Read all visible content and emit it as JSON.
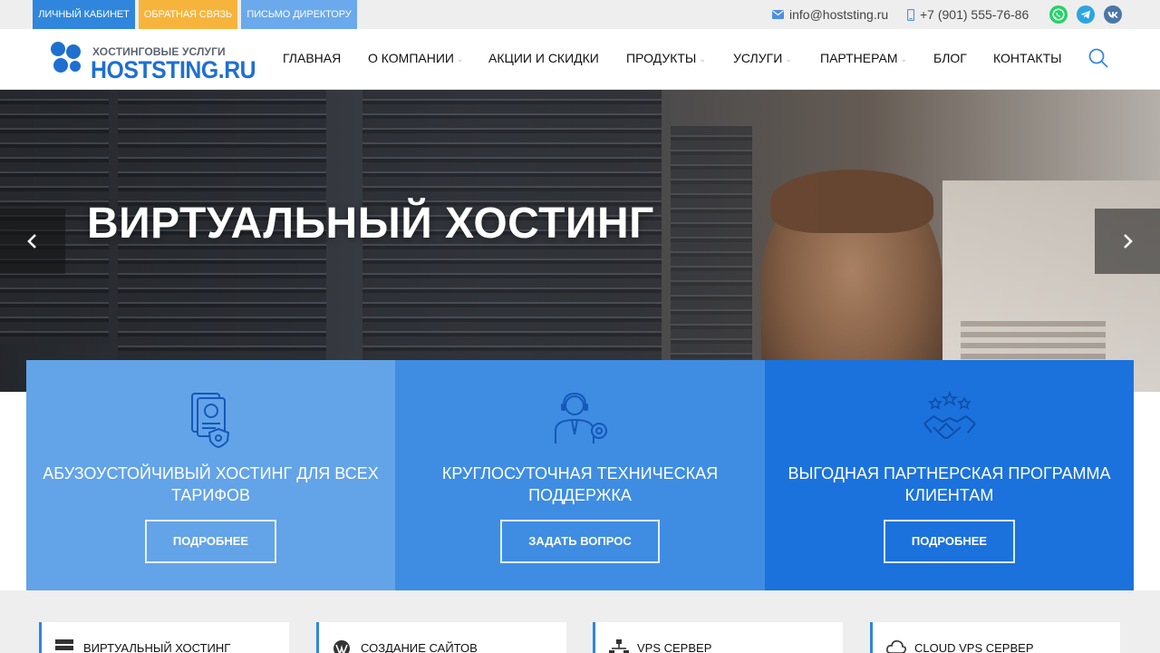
{
  "topbar": {
    "buttons": [
      {
        "label": "ЛИЧНЫЙ КАБИНЕТ"
      },
      {
        "label": "ОБРАТНАЯ СВЯЗЬ"
      },
      {
        "label": "ПИСЬМО ДИРЕКТОРУ"
      }
    ],
    "email": "info@hoststing.ru",
    "phone": "+7 (901) 555-76-86",
    "social": [
      "whatsapp-icon",
      "telegram-icon",
      "vk-icon"
    ]
  },
  "header": {
    "logo_sub": "ХОСТИНГОВЫЕ УСЛУГИ",
    "logo_main": "HOSTSTING.RU",
    "nav": [
      {
        "label": "ГЛАВНАЯ",
        "dropdown": false
      },
      {
        "label": "О КОМПАНИИ",
        "dropdown": true
      },
      {
        "label": "АКЦИИ И СКИДКИ",
        "dropdown": false
      },
      {
        "label": "ПРОДУКТЫ",
        "dropdown": true
      },
      {
        "label": "УСЛУГИ",
        "dropdown": true
      },
      {
        "label": "ПАРТНЕРАМ",
        "dropdown": true
      },
      {
        "label": "БЛОГ",
        "dropdown": false
      },
      {
        "label": "КОНТАКТЫ",
        "dropdown": false
      }
    ]
  },
  "hero": {
    "title": "ВИРТУАЛЬНЫЙ ХОСТИНГ"
  },
  "features": [
    {
      "title": "АБУЗОУСТОЙЧИВЫЙ ХОСТИНГ ДЛЯ ВСЕХ ТАРИФОВ",
      "button": "ПОДРОБНЕЕ",
      "icon": "document-badge-icon"
    },
    {
      "title": "КРУГЛОСУТОЧНАЯ ТЕХНИЧЕСКАЯ ПОДДЕРЖКА",
      "button": "ЗАДАТЬ ВОПРОС",
      "icon": "support-agent-icon"
    },
    {
      "title": "ВЫГОДНАЯ ПАРТНЕРСКАЯ ПРОГРАММА КЛИЕНТАМ",
      "button": "ПОДРОБНЕЕ",
      "icon": "handshake-stars-icon"
    }
  ],
  "services": [
    {
      "label": "ВИРТУАЛЬНЫЙ ХОСТИНГ",
      "icon": "server-icon"
    },
    {
      "label": "СОЗДАНИЕ САЙТОВ",
      "icon": "wordpress-icon"
    },
    {
      "label": "VPS СЕРВЕР",
      "icon": "network-icon"
    },
    {
      "label": "CLOUD VPS СЕРВЕР",
      "icon": "cloud-icon"
    }
  ],
  "colors": {
    "accent": "#1f6fd1",
    "feature_1": "#63a3e8",
    "feature_2": "#3e8de2",
    "feature_3": "#1b72dc",
    "topbar_btn_1": "#2f86dc",
    "topbar_btn_2": "#f7b43c",
    "topbar_btn_3": "#6aa9ec"
  }
}
